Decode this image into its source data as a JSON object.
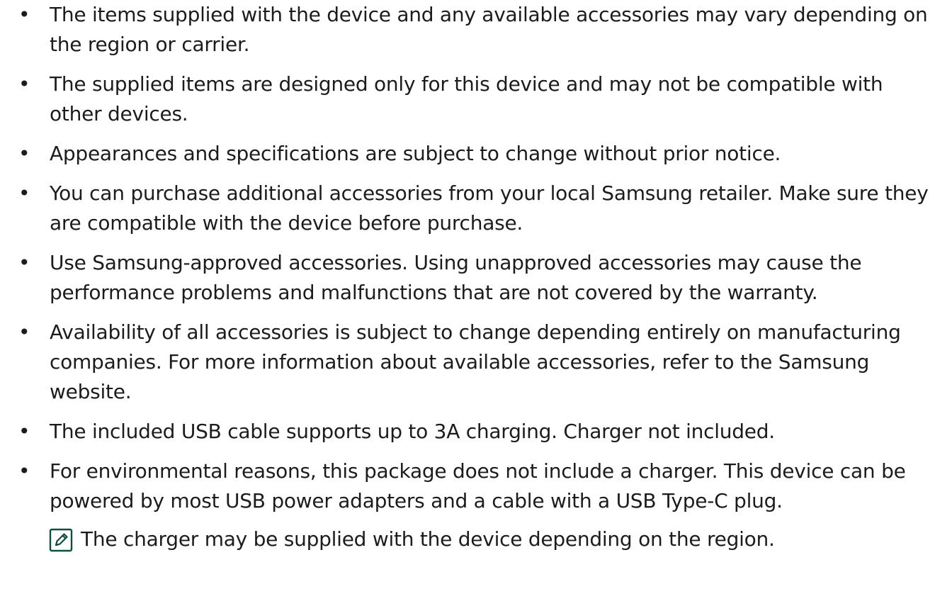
{
  "bullets": [
    "The items supplied with the device and any available accessories may vary depending on the region or carrier.",
    "The supplied items are designed only for this device and may not be compatible with other devices.",
    "Appearances and specifications are subject to change without prior notice.",
    "You can purchase additional accessories from your local Samsung retailer. Make sure they are compatible with the device before purchase.",
    "Use Samsung-approved accessories. Using unapproved accessories may cause the performance problems and malfunctions that are not covered by the warranty.",
    "Availability of all accessories is subject to change depending entirely on manufacturing companies. For more information about available accessories, refer to the Samsung website.",
    "The included USB cable supports up to 3A charging. Charger not included.",
    "For environmental reasons, this package does not include a charger. This device can be powered by most USB power adapters and a cable with a USB Type-C plug."
  ],
  "note": {
    "icon": "note-pencil-icon",
    "text": "The charger may be supplied with the device depending on the region."
  },
  "colors": {
    "text": "#1c1c1c",
    "icon_stroke": "#0f4f3f"
  }
}
